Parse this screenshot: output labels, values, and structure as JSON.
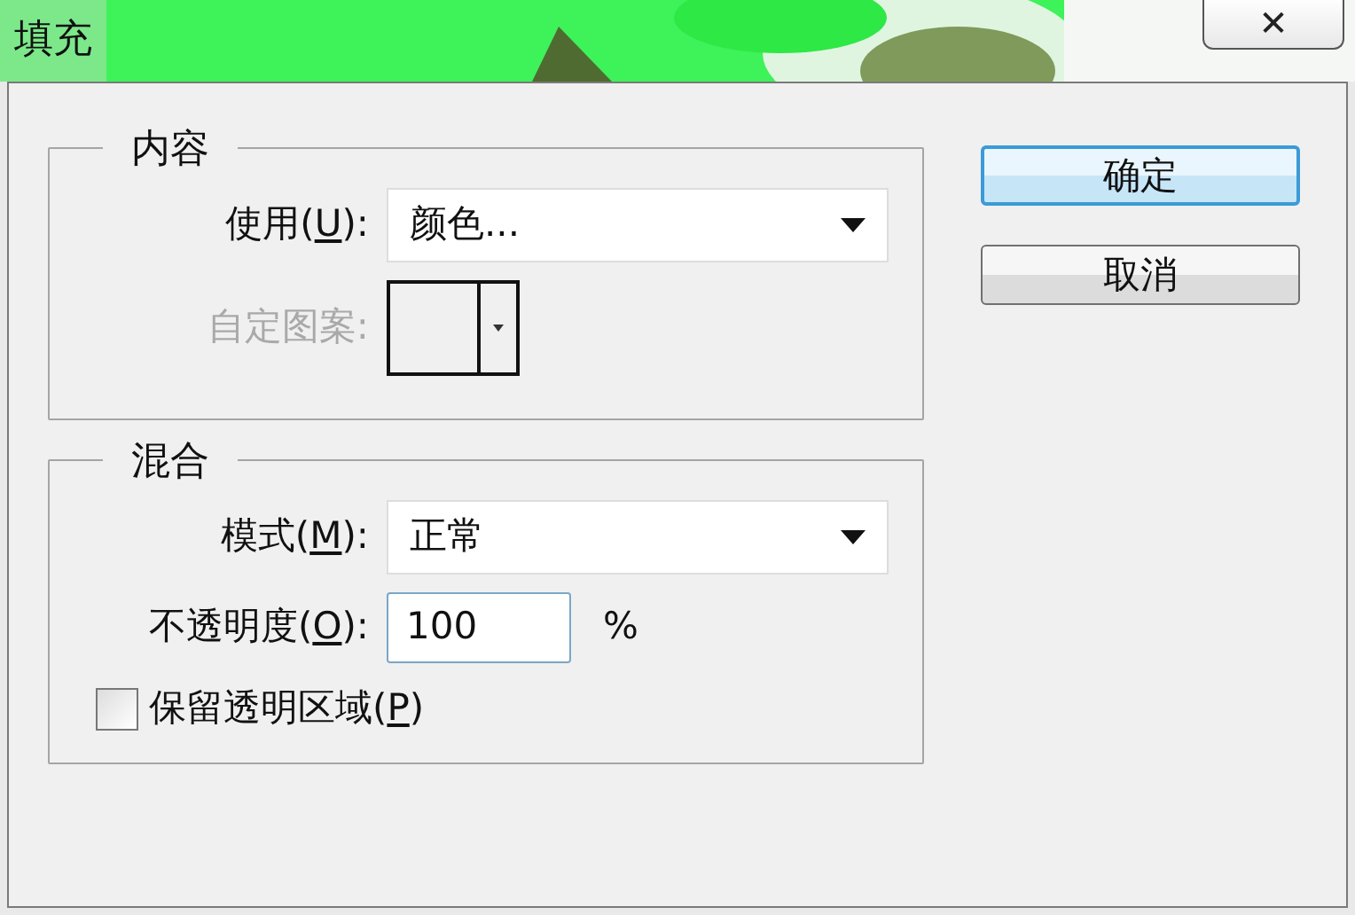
{
  "window": {
    "title": "填充",
    "close": "✕"
  },
  "groups": [
    {
      "title": "内容",
      "rows": [
        {
          "kind": "select",
          "label": [
            "使用(",
            "U",
            "):"
          ],
          "value": "颜色...",
          "disabled": false
        },
        {
          "kind": "pattern",
          "label": [
            "自定图案:"
          ],
          "disabled": true
        }
      ]
    },
    {
      "title": "混合",
      "rows": [
        {
          "kind": "select",
          "label": [
            "模式(",
            "M",
            "):"
          ],
          "value": "正常",
          "disabled": false
        },
        {
          "kind": "number",
          "label": [
            "不透明度(",
            "O",
            "):"
          ],
          "value": "100",
          "unit": "%",
          "disabled": false
        },
        {
          "kind": "checkbox",
          "label": [
            "保留透明区域(",
            "P",
            ")"
          ],
          "checked": false,
          "disabled": false
        }
      ]
    }
  ],
  "buttons": [
    {
      "label": "确定",
      "default": true
    },
    {
      "label": "取消",
      "default": false
    }
  ]
}
